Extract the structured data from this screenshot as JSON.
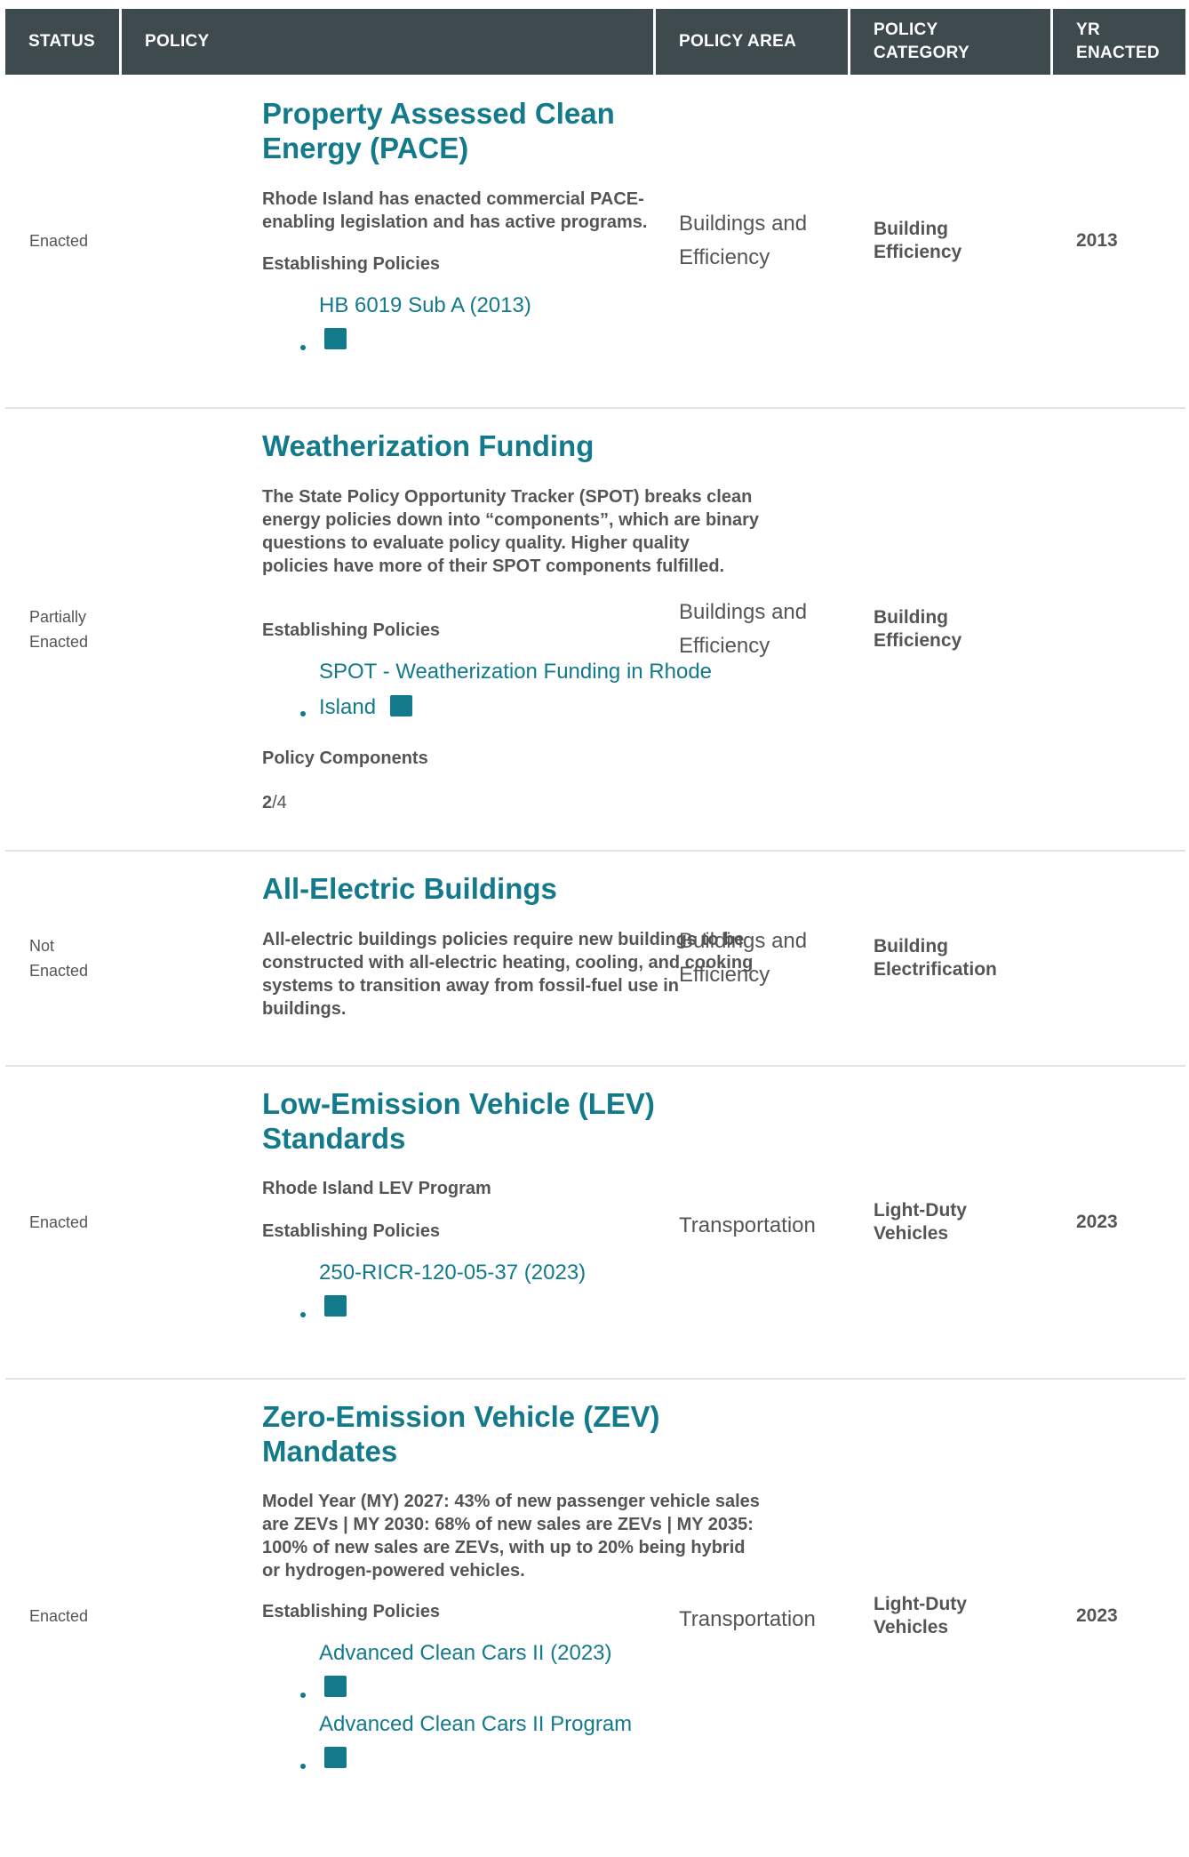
{
  "header": {
    "status": "STATUS",
    "policy": "POLICY",
    "policy_area": "POLICY AREA",
    "policy_category": "POLICY CATEGORY",
    "yr_enacted": "YR ENACTED"
  },
  "rows": [
    {
      "status": "Enacted",
      "title": "Property Assessed Clean Energy (PACE)",
      "description": "Rhode Island has enacted commercial PACE-enabling legislation and has active programs.",
      "establishing_label": "Establishing Policies",
      "links": [
        "HB 6019 Sub A (2013)"
      ],
      "area": "Buildings and Efficiency",
      "category": "Building Efficiency",
      "year": "2013"
    },
    {
      "status": "Partially Enacted",
      "title": "Weatherization Funding",
      "description": "The State Policy Opportunity Tracker (SPOT) breaks clean energy policies down into “components”, which are binary questions to evaluate policy quality. Higher quality policies have more of their SPOT components fulfilled.",
      "establishing_label": "Establishing Policies",
      "links": [
        "SPOT - Weatherization Funding in Rhode Island"
      ],
      "components_label": "Policy Components",
      "components_done": "2",
      "components_total": "/4",
      "area": "Buildings and Efficiency",
      "category": "Building Efficiency",
      "year": ""
    },
    {
      "status": "Not Enacted",
      "title": "All-Electric Buildings",
      "description": "All-electric buildings policies require new buildings to be constructed with all-electric heating, cooling, and cooking systems to transition away from fossil-fuel use in buildings.",
      "area": "Buildings and Efficiency",
      "category": "Building Electrification",
      "year": ""
    },
    {
      "status": "Enacted",
      "title": "Low-Emission Vehicle (LEV) Standards",
      "description": "Rhode Island LEV Program",
      "establishing_label": "Establishing Policies",
      "links": [
        "250-RICR-120-05-37 (2023)"
      ],
      "area": "Transportation",
      "category": "Light-Duty Vehicles",
      "year": "2023"
    },
    {
      "status": "Enacted",
      "title": "Zero-Emission Vehicle (ZEV) Mandates",
      "description": "Model Year (MY) 2027: 43% of new passenger vehicle sales are ZEVs | MY 2030: 68% of new sales are ZEVs | MY 2035: 100% of new sales are ZEVs, with up to 20% being hybrid or hydrogen-powered vehicles.",
      "establishing_label": "Establishing Policies",
      "links": [
        "Advanced Clean Cars II (2023)",
        "Advanced Clean Cars II Program"
      ],
      "area": "Transportation",
      "category": "Light-Duty Vehicles",
      "year": "2023"
    }
  ],
  "colors": {
    "header_bg": "#3e4a4e",
    "accent": "#127a8b",
    "text": "#555555",
    "divider": "#e2e2e2"
  },
  "icons": {
    "document": "document-icon"
  }
}
